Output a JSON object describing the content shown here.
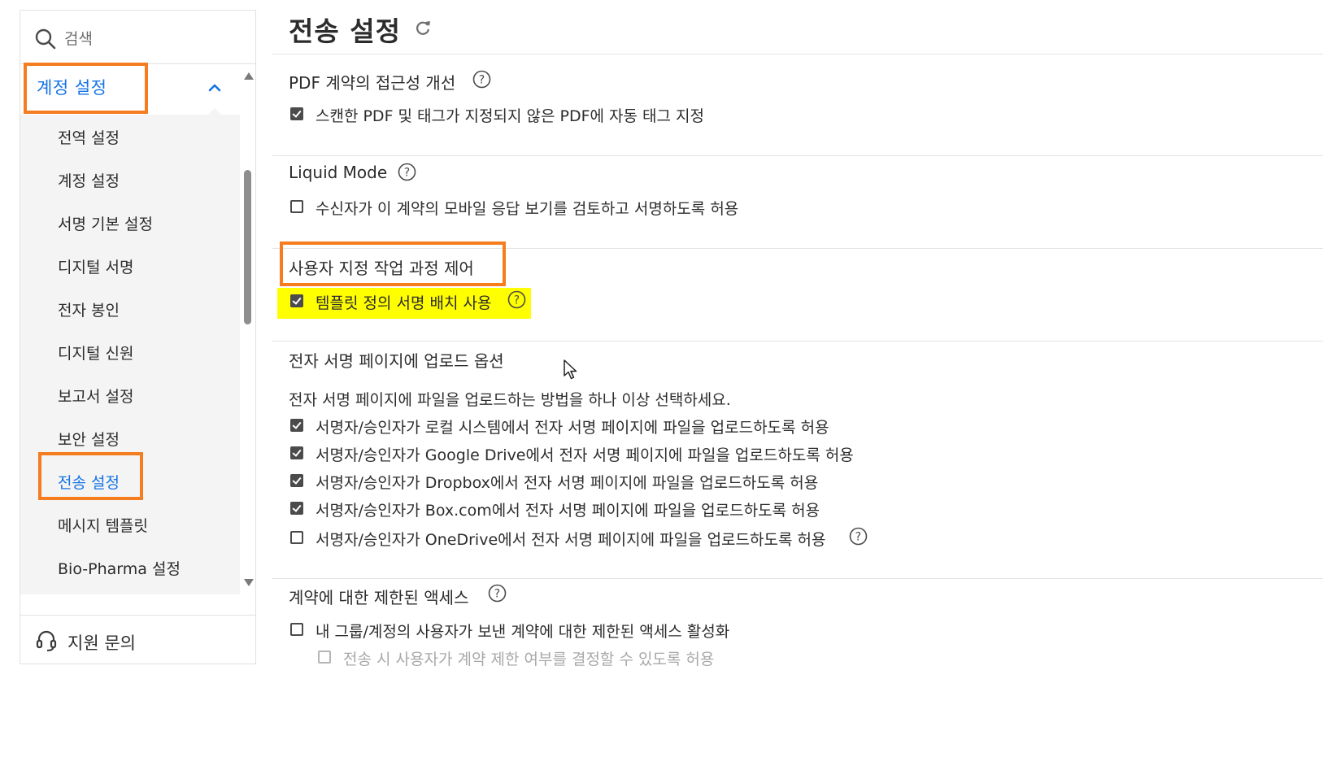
{
  "sidebar": {
    "search": {
      "placeholder": "검색",
      "icon": "search-icon"
    },
    "section_header": {
      "label": "계정 설정",
      "expanded": true
    },
    "items": [
      {
        "label": "전역 설정"
      },
      {
        "label": "계정 설정"
      },
      {
        "label": "서명 기본 설정"
      },
      {
        "label": "디지털 서명"
      },
      {
        "label": "전자 봉인"
      },
      {
        "label": "디지털 신원"
      },
      {
        "label": "보고서 설정"
      },
      {
        "label": "보안 설정"
      },
      {
        "label": "전송 설정",
        "active": true
      },
      {
        "label": "메시지 템플릿"
      },
      {
        "label": "Bio-Pharma 설정"
      }
    ],
    "support": {
      "label": "지원 문의",
      "icon": "headset-icon"
    }
  },
  "main": {
    "title": "전송 설정",
    "sections": {
      "pdf_access": {
        "title": "PDF 계약의 접근성 개선",
        "options": [
          {
            "label": "스캔한 PDF 및 태그가 지정되지 않은 PDF에 자동 태그 지정",
            "checked": true
          }
        ]
      },
      "liquid_mode": {
        "title": "Liquid Mode",
        "options": [
          {
            "label": "수신자가 이 계약의 모바일 응답 보기를 검토하고 서명하도록 허용",
            "checked": false
          }
        ]
      },
      "custom_workflow": {
        "title": "사용자 지정 작업 과정 제어",
        "options": [
          {
            "label": "템플릿 정의 서명 배치 사용",
            "checked": true
          }
        ]
      },
      "esign_upload": {
        "title": "전자 서명 페이지에 업로드 옵션",
        "description": "전자 서명 페이지에 파일을 업로드하는 방법을 하나 이상 선택하세요.",
        "options": [
          {
            "label": "서명자/승인자가 로컬 시스템에서 전자 서명 페이지에 파일을 업로드하도록 허용",
            "checked": true
          },
          {
            "label": "서명자/승인자가 Google Drive에서 전자 서명 페이지에 파일을 업로드하도록 허용",
            "checked": true
          },
          {
            "label": "서명자/승인자가 Dropbox에서 전자 서명 페이지에 파일을 업로드하도록 허용",
            "checked": true
          },
          {
            "label": "서명자/승인자가 Box.com에서 전자 서명 페이지에 파일을 업로드하도록 허용",
            "checked": true
          },
          {
            "label": "서명자/승인자가 OneDrive에서 전자 서명 페이지에 파일을 업로드하도록 허용",
            "checked": false
          }
        ]
      },
      "restricted_access": {
        "title": "계약에 대한 제한된 액세스",
        "options": [
          {
            "label": "내 그룹/계정의 사용자가 보낸 계약에 대한 제한된 액세스 활성화",
            "checked": false
          },
          {
            "label": "전송 시 사용자가 계약 제한 여부를 결정할 수 있도록 허용",
            "checked": false,
            "disabled": true
          }
        ]
      }
    }
  },
  "colors": {
    "accent_blue": "#1473e6",
    "annotation_orange": "#f57c1f",
    "annotation_yellow": "#ffff00"
  }
}
